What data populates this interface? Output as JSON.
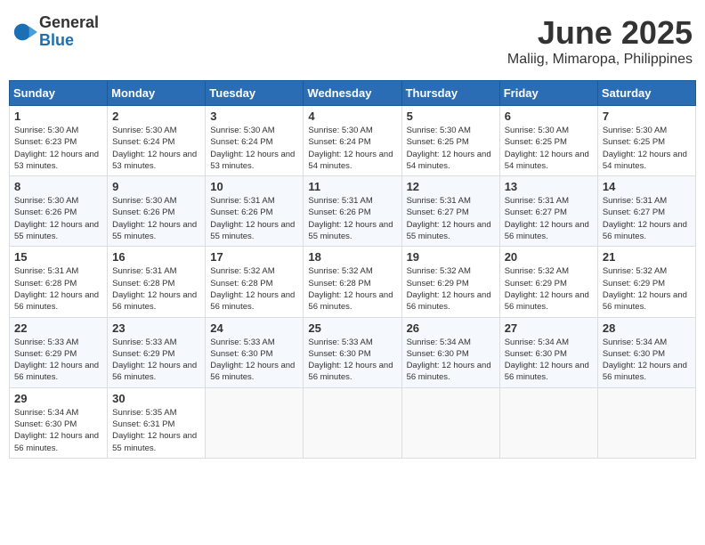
{
  "logo": {
    "general": "General",
    "blue": "Blue"
  },
  "title": {
    "month": "June 2025",
    "location": "Maliig, Mimaropa, Philippines"
  },
  "headers": [
    "Sunday",
    "Monday",
    "Tuesday",
    "Wednesday",
    "Thursday",
    "Friday",
    "Saturday"
  ],
  "weeks": [
    [
      {
        "day": "1",
        "sunrise": "5:30 AM",
        "sunset": "6:23 PM",
        "daylight": "12 hours and 53 minutes."
      },
      {
        "day": "2",
        "sunrise": "5:30 AM",
        "sunset": "6:24 PM",
        "daylight": "12 hours and 53 minutes."
      },
      {
        "day": "3",
        "sunrise": "5:30 AM",
        "sunset": "6:24 PM",
        "daylight": "12 hours and 53 minutes."
      },
      {
        "day": "4",
        "sunrise": "5:30 AM",
        "sunset": "6:24 PM",
        "daylight": "12 hours and 54 minutes."
      },
      {
        "day": "5",
        "sunrise": "5:30 AM",
        "sunset": "6:25 PM",
        "daylight": "12 hours and 54 minutes."
      },
      {
        "day": "6",
        "sunrise": "5:30 AM",
        "sunset": "6:25 PM",
        "daylight": "12 hours and 54 minutes."
      },
      {
        "day": "7",
        "sunrise": "5:30 AM",
        "sunset": "6:25 PM",
        "daylight": "12 hours and 54 minutes."
      }
    ],
    [
      {
        "day": "8",
        "sunrise": "5:30 AM",
        "sunset": "6:26 PM",
        "daylight": "12 hours and 55 minutes."
      },
      {
        "day": "9",
        "sunrise": "5:30 AM",
        "sunset": "6:26 PM",
        "daylight": "12 hours and 55 minutes."
      },
      {
        "day": "10",
        "sunrise": "5:31 AM",
        "sunset": "6:26 PM",
        "daylight": "12 hours and 55 minutes."
      },
      {
        "day": "11",
        "sunrise": "5:31 AM",
        "sunset": "6:26 PM",
        "daylight": "12 hours and 55 minutes."
      },
      {
        "day": "12",
        "sunrise": "5:31 AM",
        "sunset": "6:27 PM",
        "daylight": "12 hours and 55 minutes."
      },
      {
        "day": "13",
        "sunrise": "5:31 AM",
        "sunset": "6:27 PM",
        "daylight": "12 hours and 56 minutes."
      },
      {
        "day": "14",
        "sunrise": "5:31 AM",
        "sunset": "6:27 PM",
        "daylight": "12 hours and 56 minutes."
      }
    ],
    [
      {
        "day": "15",
        "sunrise": "5:31 AM",
        "sunset": "6:28 PM",
        "daylight": "12 hours and 56 minutes."
      },
      {
        "day": "16",
        "sunrise": "5:31 AM",
        "sunset": "6:28 PM",
        "daylight": "12 hours and 56 minutes."
      },
      {
        "day": "17",
        "sunrise": "5:32 AM",
        "sunset": "6:28 PM",
        "daylight": "12 hours and 56 minutes."
      },
      {
        "day": "18",
        "sunrise": "5:32 AM",
        "sunset": "6:28 PM",
        "daylight": "12 hours and 56 minutes."
      },
      {
        "day": "19",
        "sunrise": "5:32 AM",
        "sunset": "6:29 PM",
        "daylight": "12 hours and 56 minutes."
      },
      {
        "day": "20",
        "sunrise": "5:32 AM",
        "sunset": "6:29 PM",
        "daylight": "12 hours and 56 minutes."
      },
      {
        "day": "21",
        "sunrise": "5:32 AM",
        "sunset": "6:29 PM",
        "daylight": "12 hours and 56 minutes."
      }
    ],
    [
      {
        "day": "22",
        "sunrise": "5:33 AM",
        "sunset": "6:29 PM",
        "daylight": "12 hours and 56 minutes."
      },
      {
        "day": "23",
        "sunrise": "5:33 AM",
        "sunset": "6:29 PM",
        "daylight": "12 hours and 56 minutes."
      },
      {
        "day": "24",
        "sunrise": "5:33 AM",
        "sunset": "6:30 PM",
        "daylight": "12 hours and 56 minutes."
      },
      {
        "day": "25",
        "sunrise": "5:33 AM",
        "sunset": "6:30 PM",
        "daylight": "12 hours and 56 minutes."
      },
      {
        "day": "26",
        "sunrise": "5:34 AM",
        "sunset": "6:30 PM",
        "daylight": "12 hours and 56 minutes."
      },
      {
        "day": "27",
        "sunrise": "5:34 AM",
        "sunset": "6:30 PM",
        "daylight": "12 hours and 56 minutes."
      },
      {
        "day": "28",
        "sunrise": "5:34 AM",
        "sunset": "6:30 PM",
        "daylight": "12 hours and 56 minutes."
      }
    ],
    [
      {
        "day": "29",
        "sunrise": "5:34 AM",
        "sunset": "6:30 PM",
        "daylight": "12 hours and 56 minutes."
      },
      {
        "day": "30",
        "sunrise": "5:35 AM",
        "sunset": "6:31 PM",
        "daylight": "12 hours and 55 minutes."
      },
      null,
      null,
      null,
      null,
      null
    ]
  ]
}
